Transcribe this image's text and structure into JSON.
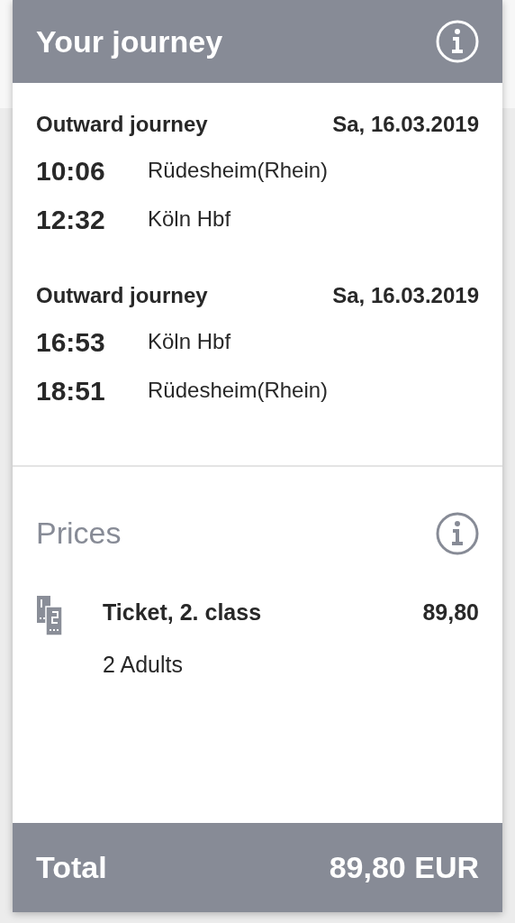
{
  "header": {
    "title": "Your journey"
  },
  "journeys": [
    {
      "label": "Outward journey",
      "date": "Sa, 16.03.2019",
      "stops": [
        {
          "time": "10:06",
          "station": "Rüdesheim(Rhein)"
        },
        {
          "time": "12:32",
          "station": "Köln Hbf"
        }
      ]
    },
    {
      "label": "Outward journey",
      "date": "Sa, 16.03.2019",
      "stops": [
        {
          "time": "16:53",
          "station": "Köln Hbf"
        },
        {
          "time": "18:51",
          "station": "Rüdesheim(Rhein)"
        }
      ]
    }
  ],
  "prices": {
    "title": "Prices",
    "items": [
      {
        "name": "Ticket, 2. class",
        "price": "89,80",
        "passengers": "2 Adults"
      }
    ]
  },
  "total": {
    "label": "Total",
    "amount": "89,80 EUR"
  }
}
